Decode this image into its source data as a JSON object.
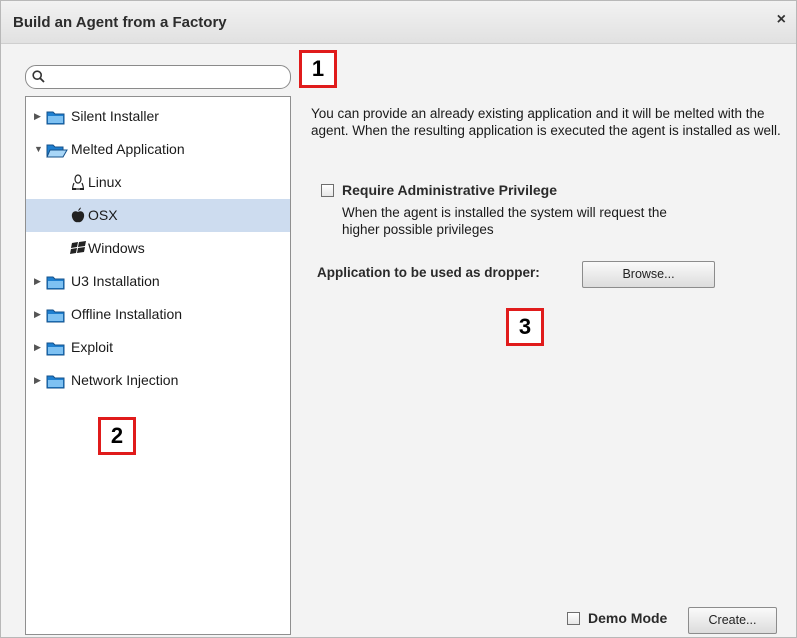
{
  "window": {
    "title": "Build an Agent from a Factory",
    "close_icon": "close-icon",
    "close_glyph": "×"
  },
  "search": {
    "value": "",
    "placeholder": "",
    "icon": "search-icon"
  },
  "tree": {
    "items": [
      {
        "label": "Silent Installer",
        "expanded": false,
        "icon": "folder-icon"
      },
      {
        "label": "Melted Application",
        "expanded": true,
        "icon": "folder-open-icon",
        "children": [
          {
            "label": "Linux",
            "icon": "linux-icon",
            "selected": false
          },
          {
            "label": "OSX",
            "icon": "apple-icon",
            "selected": true
          },
          {
            "label": "Windows",
            "icon": "windows-icon",
            "selected": false
          }
        ]
      },
      {
        "label": "U3 Installation",
        "expanded": false,
        "icon": "folder-icon"
      },
      {
        "label": "Offline Installation",
        "expanded": false,
        "icon": "folder-icon"
      },
      {
        "label": "Exploit",
        "expanded": false,
        "icon": "folder-icon"
      },
      {
        "label": "Network Injection",
        "expanded": false,
        "icon": "folder-icon"
      }
    ]
  },
  "markers": [
    "1",
    "2",
    "3"
  ],
  "main": {
    "description": "You can provide an already existing application and it will be melted with the agent. When the resulting application is executed the agent is installed as well.",
    "require_admin": {
      "label": "Require Administrative Privilege",
      "checked": false,
      "description": "When the agent is installed the system will request the higher possible privileges"
    },
    "dropper": {
      "label": "Application to be used as dropper:",
      "browse_label": "Browse..."
    }
  },
  "footer": {
    "demo_mode_label": "Demo Mode",
    "demo_mode_checked": false,
    "create_label": "Create..."
  },
  "colors": {
    "selection": "#cddcef",
    "marker_border": "#e01b1b",
    "folder_blue": "#1e7fd0"
  }
}
